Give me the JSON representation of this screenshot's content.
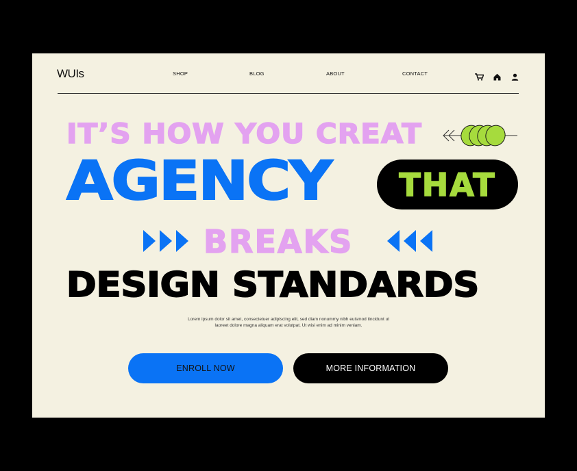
{
  "brand": {
    "logo": "WUIs"
  },
  "nav": {
    "items": [
      "SHOP",
      "BLOG",
      "ABOUT",
      "CONTACT"
    ],
    "icons": [
      "cart-icon",
      "home-icon",
      "user-icon"
    ]
  },
  "hero": {
    "line1": "IT’S HOW YOU CREAT",
    "line2": "AGENCY",
    "pill": "THAT",
    "line3": "BREAKS",
    "line4": "DESIGN STANDARDS",
    "description_line1": "Lorem ipsum dolor sit amet, consectetuer adipiscing elit, sed diam nonummy nibh euismod tincidunt ut",
    "description_line2": "laoreet dolore magna aliquam erat volutpat. Ut wisi enim ad minim veniam."
  },
  "actions": {
    "enroll_label": "ENROLL NOW",
    "more_label": "MORE INFORMATION"
  },
  "colors": {
    "background": "#f4f1e1",
    "frame": "#000000",
    "pink": "#e3a2f0",
    "blue": "#0a73f5",
    "lime": "#a6db3d",
    "black": "#000000"
  }
}
